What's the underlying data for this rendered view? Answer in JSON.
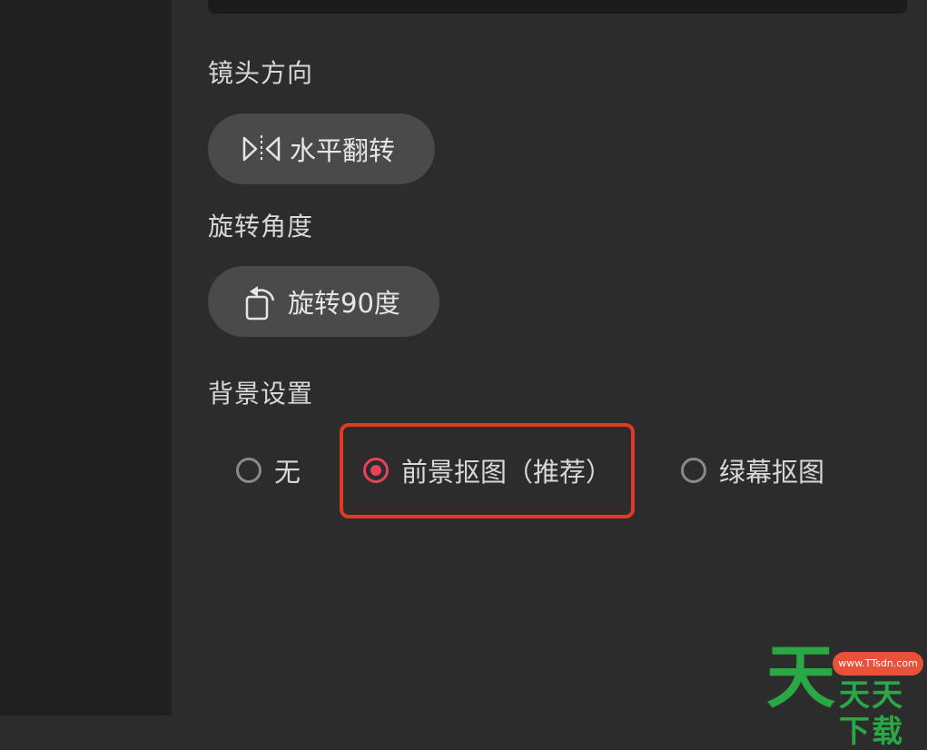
{
  "lens_direction": {
    "label": "镜头方向",
    "flip_button": {
      "label": "水平翻转",
      "icon": "flip-horizontal-icon"
    }
  },
  "rotation": {
    "label": "旋转角度",
    "rotate_button": {
      "label": "旋转90度",
      "icon": "rotate-icon"
    }
  },
  "background": {
    "label": "背景设置",
    "options": [
      {
        "label": "无",
        "selected": false
      },
      {
        "label": "前景抠图（推荐）",
        "selected": true
      },
      {
        "label": "绿幕抠图",
        "selected": false
      }
    ]
  },
  "watermark": {
    "big_char": "天",
    "url": "www.TTsdn.com",
    "text": "天天下载"
  },
  "colors": {
    "accent": "#e8425a",
    "highlight": "#e03a24",
    "panel": "#2c2c2c",
    "button": "#4a4a4a"
  }
}
